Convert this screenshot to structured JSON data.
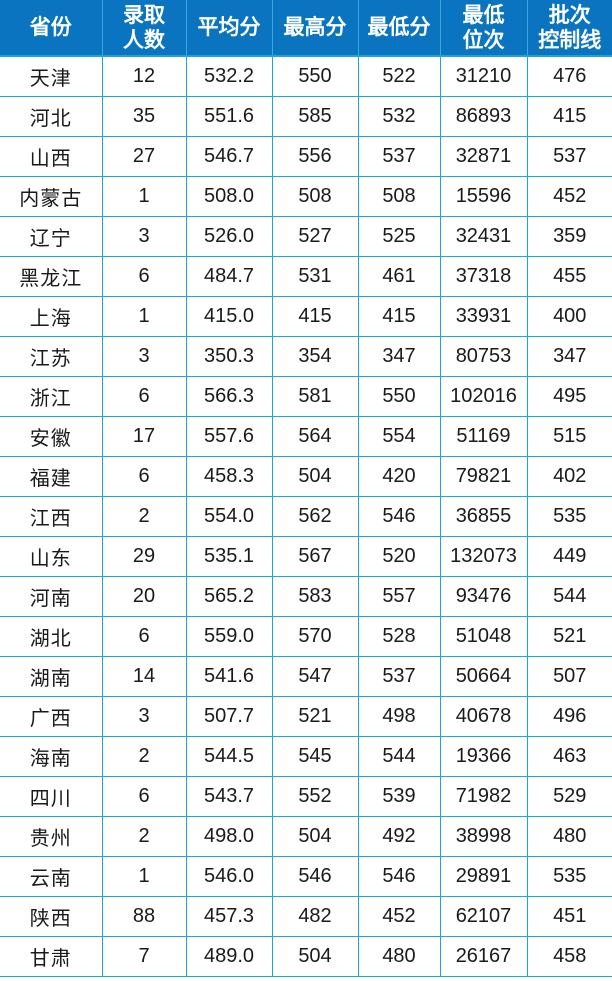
{
  "table": {
    "columns": [
      {
        "key": "province",
        "label_lines": [
          "省份"
        ],
        "align": "center"
      },
      {
        "key": "count",
        "label_lines": [
          "录取",
          "人数"
        ],
        "align": "center"
      },
      {
        "key": "avg",
        "label_lines": [
          "平均分"
        ],
        "align": "center"
      },
      {
        "key": "max",
        "label_lines": [
          "最高分"
        ],
        "align": "center"
      },
      {
        "key": "min",
        "label_lines": [
          "最低分"
        ],
        "align": "center"
      },
      {
        "key": "rank",
        "label_lines": [
          "最低",
          "位次"
        ],
        "align": "center"
      },
      {
        "key": "cutline",
        "label_lines": [
          "批次",
          "控制线"
        ],
        "align": "center"
      }
    ],
    "rows": [
      {
        "province": "天津",
        "count": "12",
        "avg": "532.2",
        "max": "550",
        "min": "522",
        "rank": "31210",
        "cutline": "476"
      },
      {
        "province": "河北",
        "count": "35",
        "avg": "551.6",
        "max": "585",
        "min": "532",
        "rank": "86893",
        "cutline": "415"
      },
      {
        "province": "山西",
        "count": "27",
        "avg": "546.7",
        "max": "556",
        "min": "537",
        "rank": "32871",
        "cutline": "537"
      },
      {
        "province": "内蒙古",
        "count": "1",
        "avg": "508.0",
        "max": "508",
        "min": "508",
        "rank": "15596",
        "cutline": "452"
      },
      {
        "province": "辽宁",
        "count": "3",
        "avg": "526.0",
        "max": "527",
        "min": "525",
        "rank": "32431",
        "cutline": "359"
      },
      {
        "province": "黑龙江",
        "count": "6",
        "avg": "484.7",
        "max": "531",
        "min": "461",
        "rank": "37318",
        "cutline": "455"
      },
      {
        "province": "上海",
        "count": "1",
        "avg": "415.0",
        "max": "415",
        "min": "415",
        "rank": "33931",
        "cutline": "400"
      },
      {
        "province": "江苏",
        "count": "3",
        "avg": "350.3",
        "max": "354",
        "min": "347",
        "rank": "80753",
        "cutline": "347"
      },
      {
        "province": "浙江",
        "count": "6",
        "avg": "566.3",
        "max": "581",
        "min": "550",
        "rank": "102016",
        "cutline": "495"
      },
      {
        "province": "安徽",
        "count": "17",
        "avg": "557.6",
        "max": "564",
        "min": "554",
        "rank": "51169",
        "cutline": "515"
      },
      {
        "province": "福建",
        "count": "6",
        "avg": "458.3",
        "max": "504",
        "min": "420",
        "rank": "79821",
        "cutline": "402"
      },
      {
        "province": "江西",
        "count": "2",
        "avg": "554.0",
        "max": "562",
        "min": "546",
        "rank": "36855",
        "cutline": "535"
      },
      {
        "province": "山东",
        "count": "29",
        "avg": "535.1",
        "max": "567",
        "min": "520",
        "rank": "132073",
        "cutline": "449"
      },
      {
        "province": "河南",
        "count": "20",
        "avg": "565.2",
        "max": "583",
        "min": "557",
        "rank": "93476",
        "cutline": "544"
      },
      {
        "province": "湖北",
        "count": "6",
        "avg": "559.0",
        "max": "570",
        "min": "528",
        "rank": "51048",
        "cutline": "521"
      },
      {
        "province": "湖南",
        "count": "14",
        "avg": "541.6",
        "max": "547",
        "min": "537",
        "rank": "50664",
        "cutline": "507"
      },
      {
        "province": "广西",
        "count": "3",
        "avg": "507.7",
        "max": "521",
        "min": "498",
        "rank": "40678",
        "cutline": "496"
      },
      {
        "province": "海南",
        "count": "2",
        "avg": "544.5",
        "max": "545",
        "min": "544",
        "rank": "19366",
        "cutline": "463"
      },
      {
        "province": "四川",
        "count": "6",
        "avg": "543.7",
        "max": "552",
        "min": "539",
        "rank": "71982",
        "cutline": "529"
      },
      {
        "province": "贵州",
        "count": "2",
        "avg": "498.0",
        "max": "504",
        "min": "492",
        "rank": "38998",
        "cutline": "480"
      },
      {
        "province": "云南",
        "count": "1",
        "avg": "546.0",
        "max": "546",
        "min": "546",
        "rank": "29891",
        "cutline": "535"
      },
      {
        "province": "陕西",
        "count": "88",
        "avg": "457.3",
        "max": "482",
        "min": "452",
        "rank": "62107",
        "cutline": "451"
      },
      {
        "province": "甘肃",
        "count": "7",
        "avg": "489.0",
        "max": "504",
        "min": "480",
        "rank": "26167",
        "cutline": "458"
      }
    ]
  },
  "colors": {
    "header_background": "#0B74C0",
    "header_text": "#FFFFFF",
    "grid_line": "#1CA3E0",
    "header_divider": "#36A9E0",
    "cell_text": "#1A1A1A",
    "cell_background": "#FFFFFF"
  }
}
